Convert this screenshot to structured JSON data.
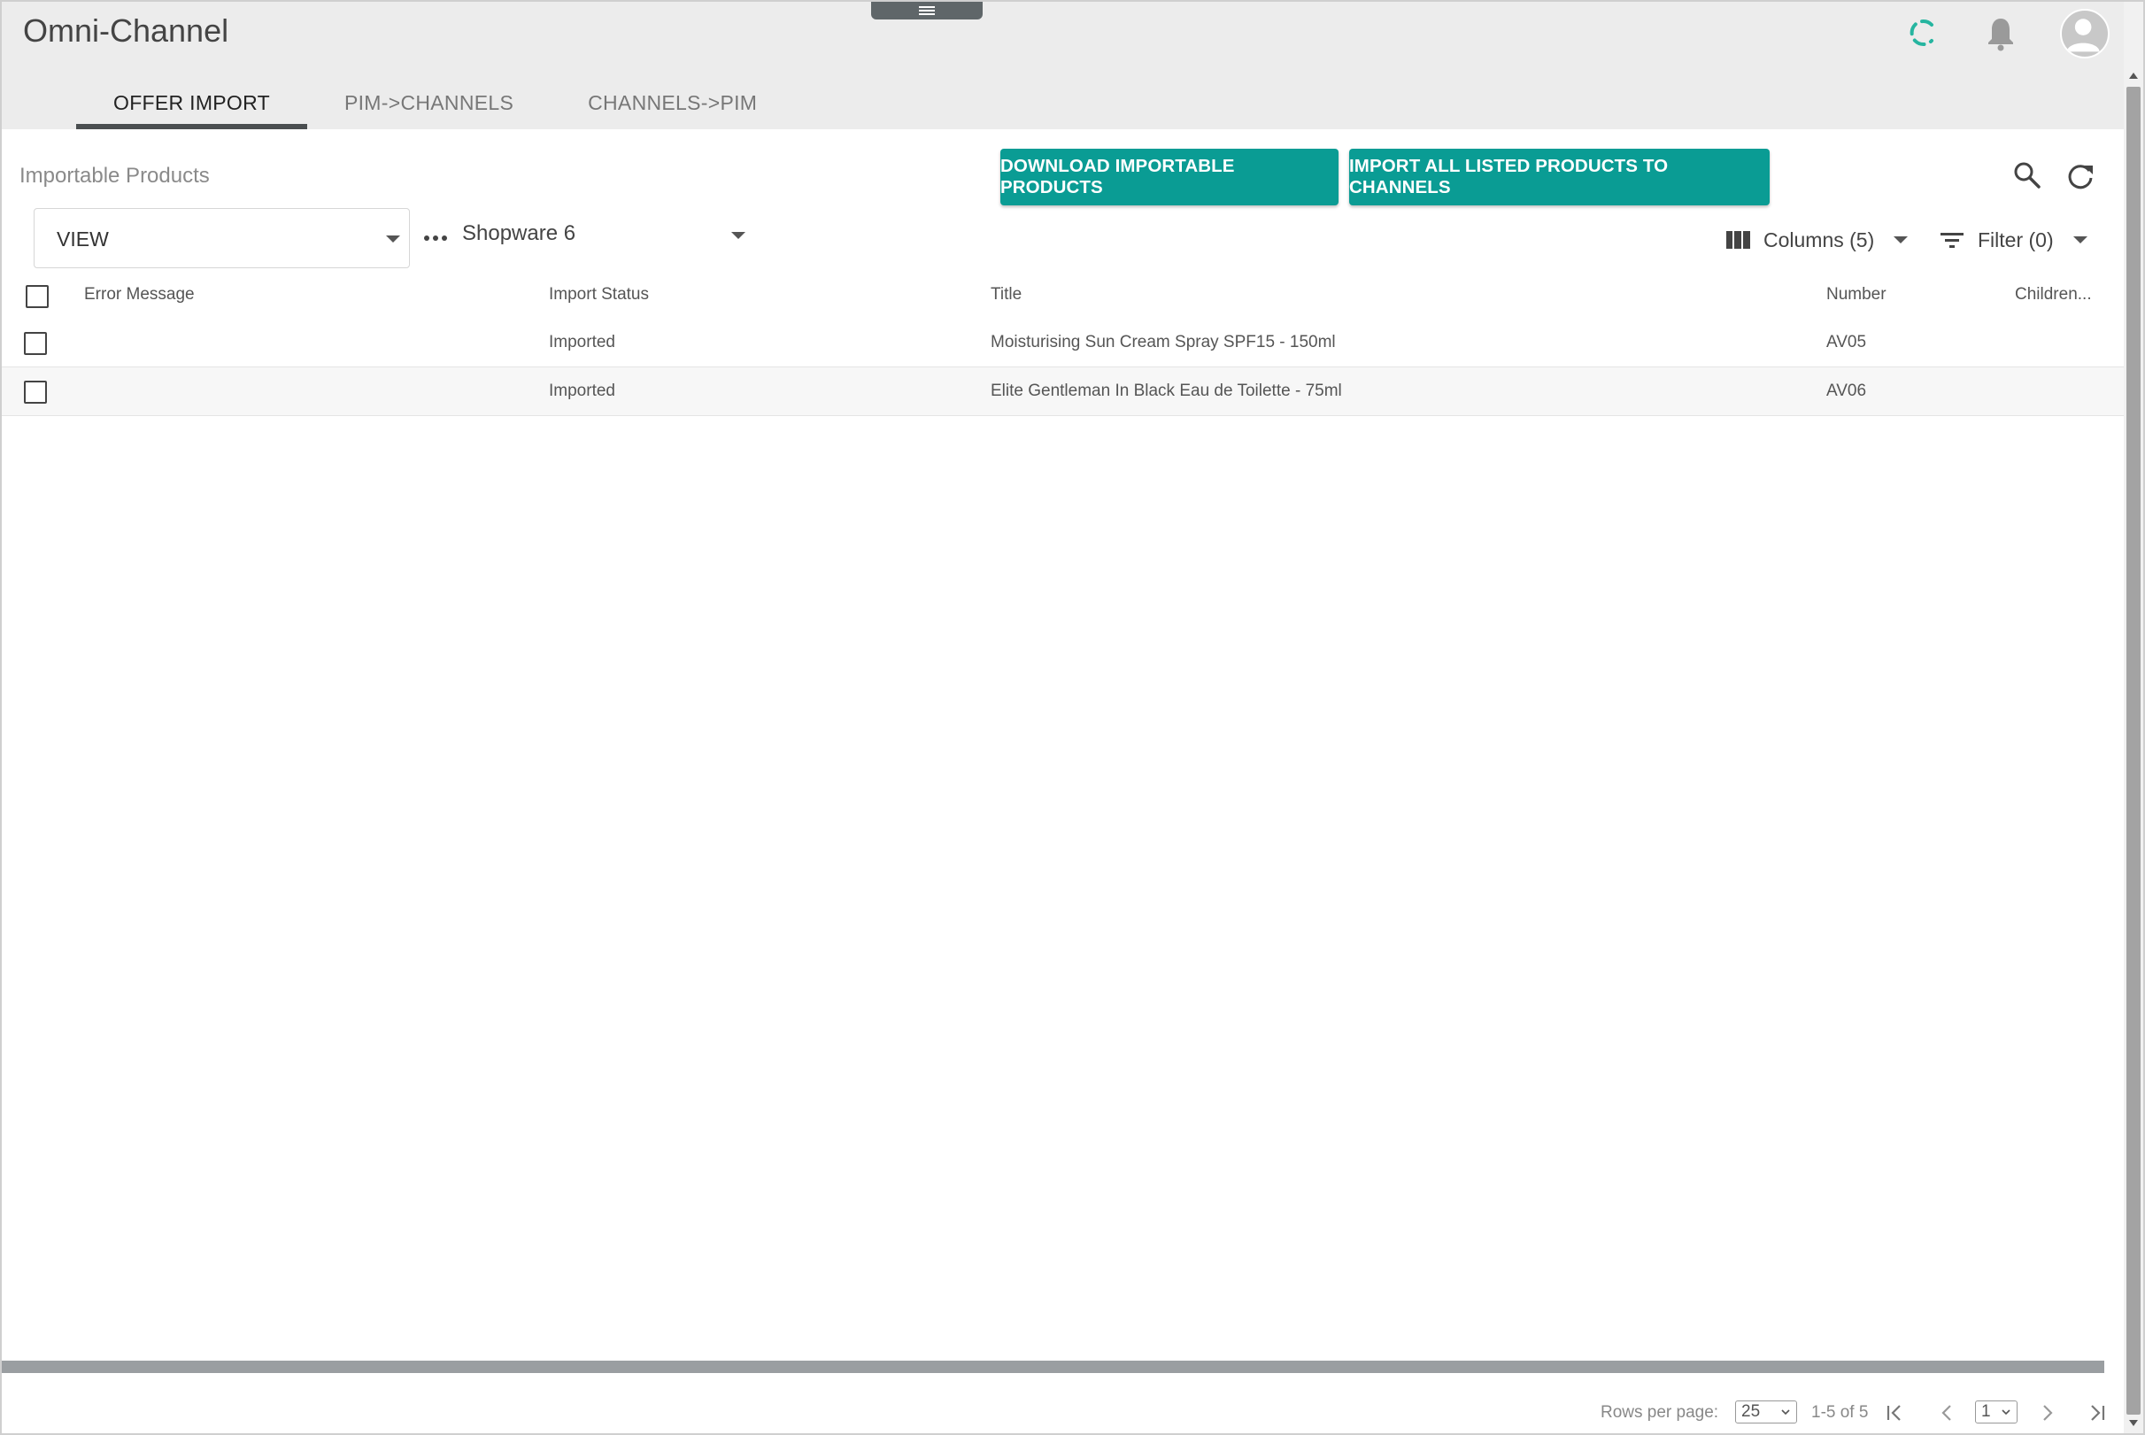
{
  "app": {
    "title": "Omni-Channel"
  },
  "header": {
    "menu_icon": "hamburger-icon",
    "loading_icon": "spinner-icon",
    "notifications_icon": "bell-icon",
    "user_icon": "avatar-icon"
  },
  "tabs": [
    {
      "label": "OFFER IMPORT",
      "active": true
    },
    {
      "label": "PIM->CHANNELS",
      "active": false
    },
    {
      "label": "CHANNELS->PIM",
      "active": false
    }
  ],
  "section": {
    "title": "Importable Products"
  },
  "actions": {
    "download_label": "DOWNLOAD IMPORTABLE PRODUCTS",
    "import_label": "IMPORT ALL LISTED PRODUCTS TO CHANNELS",
    "search_icon": "search-icon",
    "refresh_icon": "refresh-icon"
  },
  "filters": {
    "view_label": "VIEW",
    "channel_value": "Shopware 6",
    "columns_label": "Columns (5)",
    "filter_label": "Filter (0)"
  },
  "table": {
    "columns": [
      "Error Message",
      "Import Status",
      "Title",
      "Number",
      "Children..."
    ],
    "rows": [
      {
        "error_message": "",
        "import_status": "Imported",
        "title": "Moisturising Sun Cream Spray SPF15 - 150ml",
        "number": "AV05",
        "children": ""
      },
      {
        "error_message": "",
        "import_status": "Imported",
        "title": "Elite Gentleman In Black Eau de Toilette - 75ml",
        "number": "AV06",
        "children": ""
      }
    ]
  },
  "pagination": {
    "rows_per_page_label": "Rows per page:",
    "rows_per_page_value": "25",
    "range_text": "1-5 of 5",
    "current_page": "1"
  },
  "colors": {
    "accent": "#0a9c94",
    "spinner": "#26b5a0",
    "header_bg": "#ececec"
  }
}
